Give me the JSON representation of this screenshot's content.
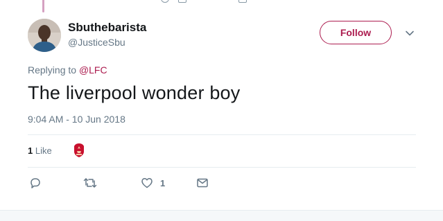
{
  "tweet": {
    "author": {
      "display_name": "Sbuthebarista",
      "handle": "@JusticeSbu",
      "avatar_icon": "user-photo"
    },
    "follow_label": "Follow",
    "replying_prefix": "Replying to",
    "replying_to": "@LFC",
    "text": "The liverpool wonder boy",
    "timestamp": "9:04 AM - 10 Jun 2018",
    "likes": {
      "count": "1",
      "label": "Like",
      "liker_icon": "lfc-crest"
    },
    "actions": {
      "reply_icon": "reply-icon",
      "retweet_icon": "retweet-icon",
      "like_icon": "heart-icon",
      "like_count": "1",
      "dm_icon": "envelope-icon"
    }
  },
  "colors": {
    "accent": "#ac1c4f",
    "text_primary": "#14171a",
    "text_secondary": "#657786",
    "divider": "#e6ecf0",
    "lfc_red": "#c8102e"
  }
}
